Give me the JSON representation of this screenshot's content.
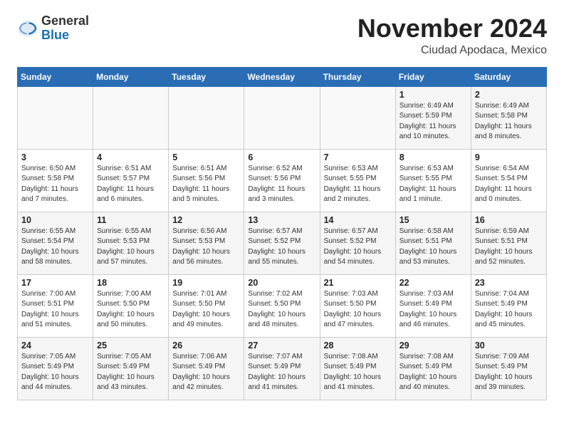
{
  "header": {
    "logo_general": "General",
    "logo_blue": "Blue",
    "month_title": "November 2024",
    "location": "Ciudad Apodaca, Mexico"
  },
  "weekdays": [
    "Sunday",
    "Monday",
    "Tuesday",
    "Wednesday",
    "Thursday",
    "Friday",
    "Saturday"
  ],
  "weeks": [
    [
      {
        "day": "",
        "info": ""
      },
      {
        "day": "",
        "info": ""
      },
      {
        "day": "",
        "info": ""
      },
      {
        "day": "",
        "info": ""
      },
      {
        "day": "",
        "info": ""
      },
      {
        "day": "1",
        "info": "Sunrise: 6:49 AM\nSunset: 5:59 PM\nDaylight: 11 hours and 10 minutes."
      },
      {
        "day": "2",
        "info": "Sunrise: 6:49 AM\nSunset: 5:58 PM\nDaylight: 11 hours and 8 minutes."
      }
    ],
    [
      {
        "day": "3",
        "info": "Sunrise: 6:50 AM\nSunset: 5:58 PM\nDaylight: 11 hours and 7 minutes."
      },
      {
        "day": "4",
        "info": "Sunrise: 6:51 AM\nSunset: 5:57 PM\nDaylight: 11 hours and 6 minutes."
      },
      {
        "day": "5",
        "info": "Sunrise: 6:51 AM\nSunset: 5:56 PM\nDaylight: 11 hours and 5 minutes."
      },
      {
        "day": "6",
        "info": "Sunrise: 6:52 AM\nSunset: 5:56 PM\nDaylight: 11 hours and 3 minutes."
      },
      {
        "day": "7",
        "info": "Sunrise: 6:53 AM\nSunset: 5:55 PM\nDaylight: 11 hours and 2 minutes."
      },
      {
        "day": "8",
        "info": "Sunrise: 6:53 AM\nSunset: 5:55 PM\nDaylight: 11 hours and 1 minute."
      },
      {
        "day": "9",
        "info": "Sunrise: 6:54 AM\nSunset: 5:54 PM\nDaylight: 11 hours and 0 minutes."
      }
    ],
    [
      {
        "day": "10",
        "info": "Sunrise: 6:55 AM\nSunset: 5:54 PM\nDaylight: 10 hours and 58 minutes."
      },
      {
        "day": "11",
        "info": "Sunrise: 6:55 AM\nSunset: 5:53 PM\nDaylight: 10 hours and 57 minutes."
      },
      {
        "day": "12",
        "info": "Sunrise: 6:56 AM\nSunset: 5:53 PM\nDaylight: 10 hours and 56 minutes."
      },
      {
        "day": "13",
        "info": "Sunrise: 6:57 AM\nSunset: 5:52 PM\nDaylight: 10 hours and 55 minutes."
      },
      {
        "day": "14",
        "info": "Sunrise: 6:57 AM\nSunset: 5:52 PM\nDaylight: 10 hours and 54 minutes."
      },
      {
        "day": "15",
        "info": "Sunrise: 6:58 AM\nSunset: 5:51 PM\nDaylight: 10 hours and 53 minutes."
      },
      {
        "day": "16",
        "info": "Sunrise: 6:59 AM\nSunset: 5:51 PM\nDaylight: 10 hours and 52 minutes."
      }
    ],
    [
      {
        "day": "17",
        "info": "Sunrise: 7:00 AM\nSunset: 5:51 PM\nDaylight: 10 hours and 51 minutes."
      },
      {
        "day": "18",
        "info": "Sunrise: 7:00 AM\nSunset: 5:50 PM\nDaylight: 10 hours and 50 minutes."
      },
      {
        "day": "19",
        "info": "Sunrise: 7:01 AM\nSunset: 5:50 PM\nDaylight: 10 hours and 49 minutes."
      },
      {
        "day": "20",
        "info": "Sunrise: 7:02 AM\nSunset: 5:50 PM\nDaylight: 10 hours and 48 minutes."
      },
      {
        "day": "21",
        "info": "Sunrise: 7:03 AM\nSunset: 5:50 PM\nDaylight: 10 hours and 47 minutes."
      },
      {
        "day": "22",
        "info": "Sunrise: 7:03 AM\nSunset: 5:49 PM\nDaylight: 10 hours and 46 minutes."
      },
      {
        "day": "23",
        "info": "Sunrise: 7:04 AM\nSunset: 5:49 PM\nDaylight: 10 hours and 45 minutes."
      }
    ],
    [
      {
        "day": "24",
        "info": "Sunrise: 7:05 AM\nSunset: 5:49 PM\nDaylight: 10 hours and 44 minutes."
      },
      {
        "day": "25",
        "info": "Sunrise: 7:05 AM\nSunset: 5:49 PM\nDaylight: 10 hours and 43 minutes."
      },
      {
        "day": "26",
        "info": "Sunrise: 7:06 AM\nSunset: 5:49 PM\nDaylight: 10 hours and 42 minutes."
      },
      {
        "day": "27",
        "info": "Sunrise: 7:07 AM\nSunset: 5:49 PM\nDaylight: 10 hours and 41 minutes."
      },
      {
        "day": "28",
        "info": "Sunrise: 7:08 AM\nSunset: 5:49 PM\nDaylight: 10 hours and 41 minutes."
      },
      {
        "day": "29",
        "info": "Sunrise: 7:08 AM\nSunset: 5:49 PM\nDaylight: 10 hours and 40 minutes."
      },
      {
        "day": "30",
        "info": "Sunrise: 7:09 AM\nSunset: 5:49 PM\nDaylight: 10 hours and 39 minutes."
      }
    ]
  ]
}
